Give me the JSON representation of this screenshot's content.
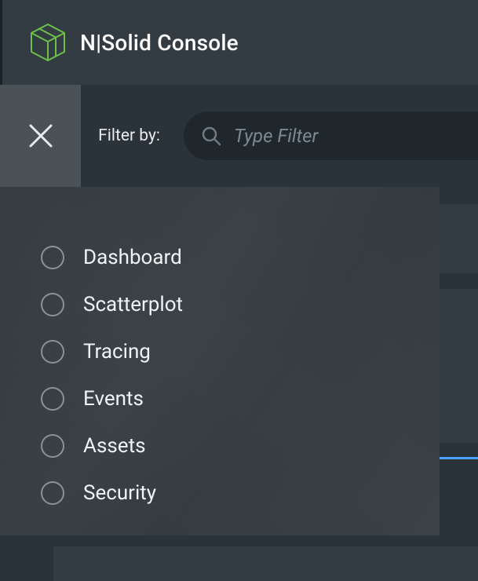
{
  "header": {
    "app_title": "N|Solid Console"
  },
  "filter": {
    "label": "Filter by:",
    "placeholder": "Type Filter",
    "value": ""
  },
  "menu": {
    "items": [
      {
        "label": "Dashboard"
      },
      {
        "label": "Scatterplot"
      },
      {
        "label": "Tracing"
      },
      {
        "label": "Events"
      },
      {
        "label": "Assets"
      },
      {
        "label": "Security"
      }
    ]
  },
  "colors": {
    "accent": "#6cc04a"
  }
}
